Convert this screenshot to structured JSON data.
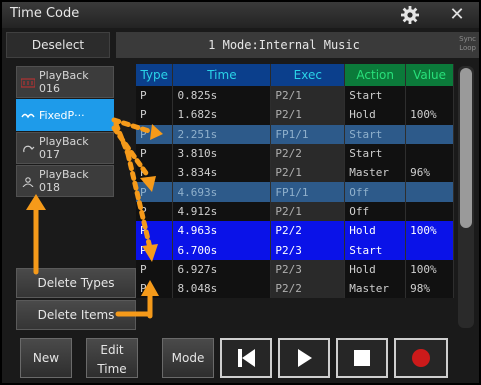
{
  "window": {
    "title": "Time Code"
  },
  "topbar": {
    "deselect_label": "Deselect",
    "mode_text": "1  Mode:Internal Music",
    "sync_line1": "Sync",
    "sync_line2": "Loop"
  },
  "playbacks": [
    {
      "label": "PlayBack 016",
      "line1": "PlayBack",
      "line2": "016",
      "icon": "playback-icon",
      "selected": false
    },
    {
      "label": "FixedP···",
      "line1": "FixedP···",
      "line2": "",
      "icon": "fixture-icon",
      "selected": true
    },
    {
      "label": "PlayBack 017",
      "line1": "PlayBack",
      "line2": "017",
      "icon": "loop-icon",
      "selected": false
    },
    {
      "label": "PlayBack 018",
      "line1": "PlayBack",
      "line2": "018",
      "icon": "person-icon",
      "selected": false
    }
  ],
  "left_buttons": {
    "delete_types": "Delete Types",
    "delete_items": "Delete Items"
  },
  "table": {
    "headers": [
      "Type",
      "Time",
      "Exec",
      "Action",
      "Value"
    ],
    "rows": [
      {
        "type": "P",
        "time": "0.825s",
        "exec": "P2/1",
        "action": "Start",
        "value": "",
        "style": "normal"
      },
      {
        "type": "P",
        "time": "1.682s",
        "exec": "P2/1",
        "action": "Hold",
        "value": "100%",
        "style": "normal"
      },
      {
        "type": "P",
        "time": "2.251s",
        "exec": "FP1/1",
        "action": "Start",
        "value": "",
        "style": "hl"
      },
      {
        "type": "P",
        "time": "3.810s",
        "exec": "P2/2",
        "action": "Start",
        "value": "",
        "style": "normal"
      },
      {
        "type": "P",
        "time": "3.834s",
        "exec": "P2/1",
        "action": "Master",
        "value": "96%",
        "style": "normal"
      },
      {
        "type": "P",
        "time": "4.693s",
        "exec": "FP1/1",
        "action": "Off",
        "value": "",
        "style": "hl"
      },
      {
        "type": "P",
        "time": "4.912s",
        "exec": "P2/1",
        "action": "Off",
        "value": "",
        "style": "normal"
      },
      {
        "type": "P",
        "time": "4.963s",
        "exec": "P2/2",
        "action": "Hold",
        "value": "100%",
        "style": "blue"
      },
      {
        "type": "P",
        "time": "6.700s",
        "exec": "P2/3",
        "action": "Start",
        "value": "",
        "style": "blue"
      },
      {
        "type": "P",
        "time": "6.927s",
        "exec": "P2/3",
        "action": "Hold",
        "value": "100%",
        "style": "normal"
      },
      {
        "type": "P",
        "time": "8.048s",
        "exec": "P2/2",
        "action": "Master",
        "value": "98%",
        "style": "normal"
      }
    ]
  },
  "bottom": {
    "new_label": "New",
    "edit_time_line1": "Edit",
    "edit_time_line2": "Time",
    "mode_label": "Mode"
  },
  "colors": {
    "accent_blue": "#1e9bea",
    "row_highlight": "#2d5a8a",
    "row_blue": "#0a12e8",
    "annotation_orange": "#f59a1a",
    "record_red": "#cc1a1a"
  }
}
